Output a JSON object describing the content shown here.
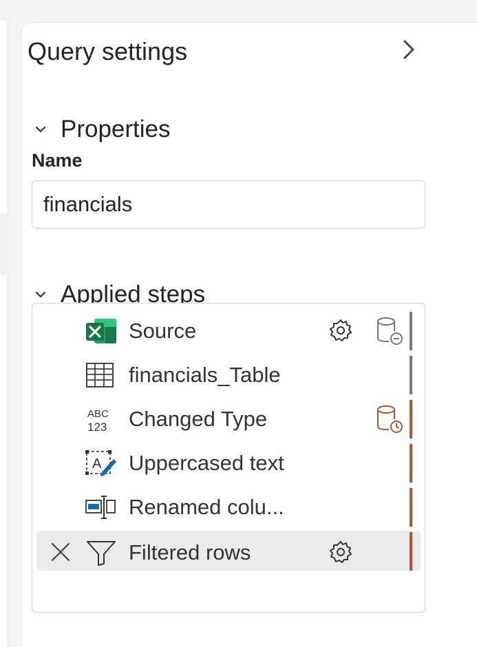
{
  "panel": {
    "title": "Query settings",
    "collapse_icon": "chevron-right-icon"
  },
  "properties": {
    "heading": "Properties",
    "name_label": "Name",
    "name_value": "financials"
  },
  "applied_steps": {
    "heading": "Applied steps",
    "steps": [
      {
        "label": "Source",
        "icon": "excel-icon",
        "has_gear": true,
        "has_db": true,
        "db_color": "#777777",
        "bar_color": "#7a7a7a"
      },
      {
        "label": "financials_Table",
        "icon": "table-icon",
        "has_gear": false,
        "has_db": false,
        "bar_color": "#7a7a7a"
      },
      {
        "label": "Changed Type",
        "icon": "abc123-icon",
        "has_gear": false,
        "has_db": true,
        "db_color": "#b5532a",
        "bar_color": "#b5532a"
      },
      {
        "label": "Uppercased text",
        "icon": "text-edit-icon",
        "has_gear": false,
        "has_db": false,
        "bar_color": "#b5532a"
      },
      {
        "label": "Renamed colu...",
        "icon": "rename-column-icon",
        "has_gear": false,
        "has_db": false,
        "bar_color": "#b5532a"
      },
      {
        "label": "Filtered rows",
        "icon": "filter-icon",
        "has_gear": true,
        "has_db": false,
        "selected": true,
        "bar_color": "#b5532a"
      }
    ]
  },
  "colors": {
    "accent_orange": "#b5532a",
    "neutral_bar": "#7a7a7a",
    "excel_green": "#107c41",
    "icon_blue": "#0f6cbd"
  }
}
